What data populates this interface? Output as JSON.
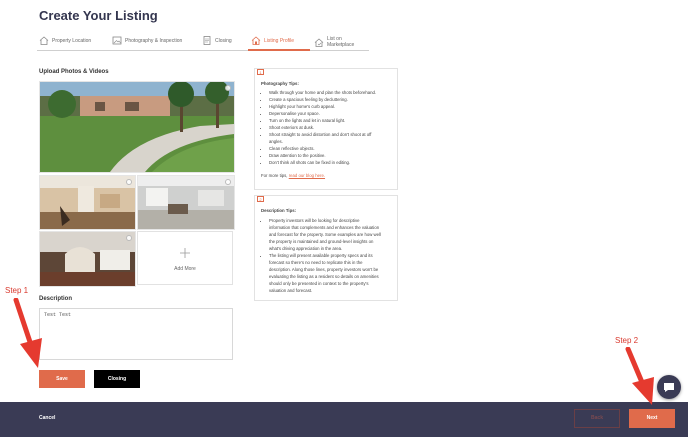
{
  "page": {
    "title": "Create Your Listing"
  },
  "tabs": [
    {
      "label": "Property Location",
      "icon": "house-icon"
    },
    {
      "label": "Photography & Inspection",
      "icon": "photo-icon"
    },
    {
      "label": "Closing",
      "icon": "document-icon"
    },
    {
      "label": "Listing Profile",
      "icon": "profile-icon",
      "active": true
    },
    {
      "label": "List on Marketplace",
      "icon": "marketplace-icon"
    }
  ],
  "upload": {
    "label": "Upload Photos & Videos",
    "add_more": "Add More"
  },
  "photography_tips": {
    "number": "1",
    "heading": "Photography Tips:",
    "items": [
      "Walk through your home and plan the shots beforehand.",
      "Create a spacious feeling by decluttering.",
      "Highlight your home's curb appeal.",
      "Depersonalise your space.",
      "Turn on the lights and let in natural light.",
      "Shoot exteriors at dusk.",
      "Shoot straight to avoid distortion and don't shoot at off",
      "angles.",
      "Clean reflective objects.",
      "Draw attention to the positive.",
      "Don't think all shots can be fixed in editing."
    ],
    "footer_text": "For more tips,",
    "footer_link": "read our blog here."
  },
  "description_tips": {
    "number": "2",
    "heading": "Description Tips:",
    "item1_lines": [
      "Property investors will be looking for descriptive",
      "information that complements and enhances the valuation",
      "and forecast for the property. Some examples are how well",
      "the property is maintained and ground-level insights on",
      "what's driving appreciation in the area."
    ],
    "item2_lines": [
      "The listing will present available property specs and its",
      "forecast so there's no need to replicate this in the",
      "description. Along those lines, property investors won't be",
      "evaluating the listing as a resident so details on amenities",
      "should only be presented in context to the property's",
      "valuation and forecast."
    ]
  },
  "description": {
    "label": "Description",
    "value": "Test Test"
  },
  "buttons": {
    "save": "Save",
    "closing": "Closing",
    "cancel": "Cancel",
    "back": "Back",
    "next": "Next"
  },
  "annotations": {
    "step1": "Step 1",
    "step2": "Step 2"
  },
  "colors": {
    "accent": "#e06b4b",
    "dark": "#3a3b55",
    "arrow": "#e53a2f"
  }
}
